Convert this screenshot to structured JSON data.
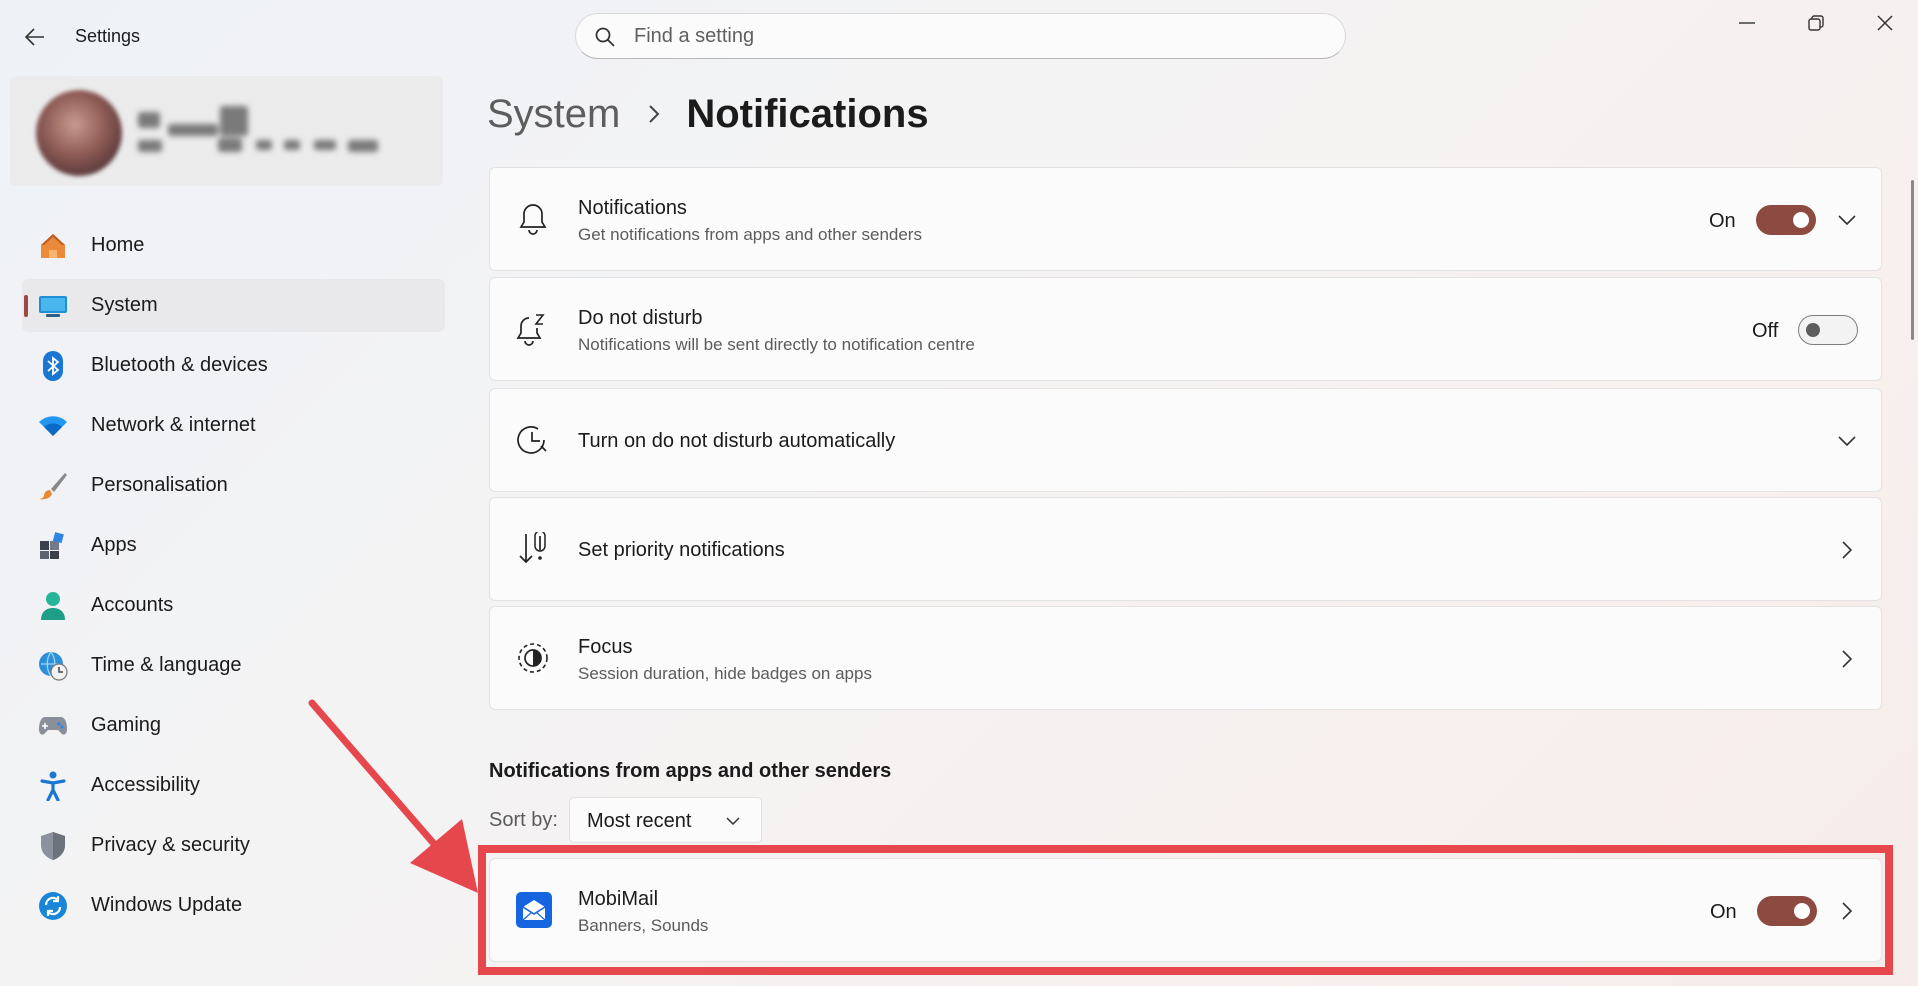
{
  "window": {
    "title": "Settings",
    "search_placeholder": "Find a setting"
  },
  "sidebar": {
    "items": [
      {
        "label": "Home",
        "icon": "home-icon"
      },
      {
        "label": "System",
        "icon": "system-monitor-icon",
        "selected": true
      },
      {
        "label": "Bluetooth & devices",
        "icon": "bluetooth-icon"
      },
      {
        "label": "Network & internet",
        "icon": "wifi-icon"
      },
      {
        "label": "Personalisation",
        "icon": "paintbrush-icon"
      },
      {
        "label": "Apps",
        "icon": "apps-icon"
      },
      {
        "label": "Accounts",
        "icon": "person-icon"
      },
      {
        "label": "Time & language",
        "icon": "globe-clock-icon"
      },
      {
        "label": "Gaming",
        "icon": "gamepad-icon"
      },
      {
        "label": "Accessibility",
        "icon": "accessibility-icon"
      },
      {
        "label": "Privacy & security",
        "icon": "shield-icon"
      },
      {
        "label": "Windows Update",
        "icon": "sync-icon"
      }
    ]
  },
  "breadcrumb": {
    "parent": "System",
    "current": "Notifications"
  },
  "settings": {
    "notifications": {
      "title": "Notifications",
      "subtitle": "Get notifications from apps and other senders",
      "state": "On",
      "toggle_on": true
    },
    "dnd": {
      "title": "Do not disturb",
      "subtitle": "Notifications will be sent directly to notification centre",
      "state": "Off",
      "toggle_on": false
    },
    "dnd_auto": {
      "title": "Turn on do not disturb automatically"
    },
    "priority": {
      "title": "Set priority notifications"
    },
    "focus": {
      "title": "Focus",
      "subtitle": "Session duration, hide badges on apps"
    }
  },
  "apps_section": {
    "title": "Notifications from apps and other senders",
    "sort_label": "Sort by:",
    "sort_value": "Most recent",
    "apps": [
      {
        "name": "MobiMail",
        "subtitle": "Banners, Sounds",
        "state": "On",
        "toggle_on": true
      }
    ]
  },
  "colors": {
    "accent": "#8c4a41",
    "highlight_box": "#e5474c"
  }
}
